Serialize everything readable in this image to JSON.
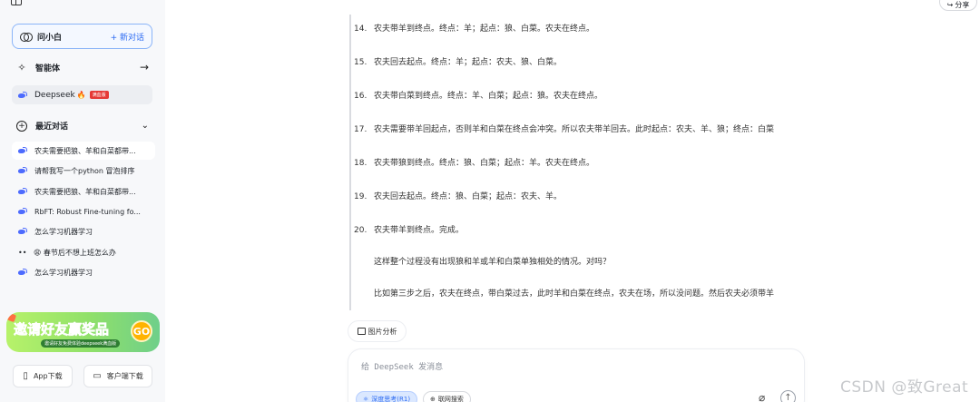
{
  "sidebar": {
    "ask_label": "问小白",
    "new_chat": "+ 新对话",
    "agents_label": "智能体",
    "deepseek": {
      "label": "Deepseek",
      "fire": "🔥",
      "badge": "满血版"
    },
    "recent_label": "最近对话",
    "history": [
      {
        "text": "农夫需要把狼、羊和白菜都带...",
        "icon": "deepseek-whale-icon"
      },
      {
        "text": "请帮我写一个python 冒泡排序",
        "icon": "deepseek-whale-icon"
      },
      {
        "text": "农夫需要把狼、羊和白菜都带...",
        "icon": "deepseek-whale-icon"
      },
      {
        "text": "RbFT: Robust Fine-tuning fo...",
        "icon": "deepseek-whale-icon"
      },
      {
        "text": "怎么学习机器学习",
        "icon": "deepseek-whale-icon"
      },
      {
        "text": "😩 春节后不想上班怎么办",
        "icon": "dots-icon"
      },
      {
        "text": "怎么学习机器学习",
        "icon": "deepseek-whale-icon"
      }
    ],
    "promo": {
      "title": "邀请好友赢奖品",
      "sub": "邀请好友免费体验deepseek满血版",
      "go": "GO"
    },
    "app_download": "App下载",
    "client_download": "客户端下载"
  },
  "main": {
    "share": "分享",
    "steps": [
      {
        "num": "14.",
        "text": "农夫带羊到终点。终点：羊；起点：狼、白菜。农夫在终点。"
      },
      {
        "num": "15.",
        "text": "农夫回去起点。终点：羊；起点：农夫、狼、白菜。"
      },
      {
        "num": "16.",
        "text": "农夫带白菜到终点。终点：羊、白菜；起点：狼。农夫在终点。"
      },
      {
        "num": "17.",
        "text": "农夫需要带羊回起点，否则羊和白菜在终点会冲突。所以农夫带羊回去。此时起点：农夫、羊、狼；终点：白菜"
      },
      {
        "num": "18.",
        "text": "农夫带狼到终点。终点：狼、白菜；起点：羊。农夫在终点。"
      },
      {
        "num": "19.",
        "text": "农夫回去起点。终点：狼、白菜；起点：农夫、羊。"
      },
      {
        "num": "20.",
        "text": "农夫带羊到终点。完成。"
      }
    ],
    "para1": "这样整个过程没有出现狼和羊或羊和白菜单独相处的情况。对吗？",
    "para2": "比如第三步之后，农夫在终点，带白菜过去，此时羊和白菜在终点，农夫在场，所以没问题。然后农夫必须带羊",
    "image_analysis": "图片分析",
    "composer": {
      "placeholder": "给 DeepSeek 发消息",
      "deep_think": "深度思考(R1)",
      "web_search": "联网搜索"
    }
  },
  "watermark": "CSDN @致Great",
  "colors": {
    "accent": "#2c6bf2",
    "whale": "#4d6bfe",
    "sidebar_bg": "#f7f8fa"
  }
}
